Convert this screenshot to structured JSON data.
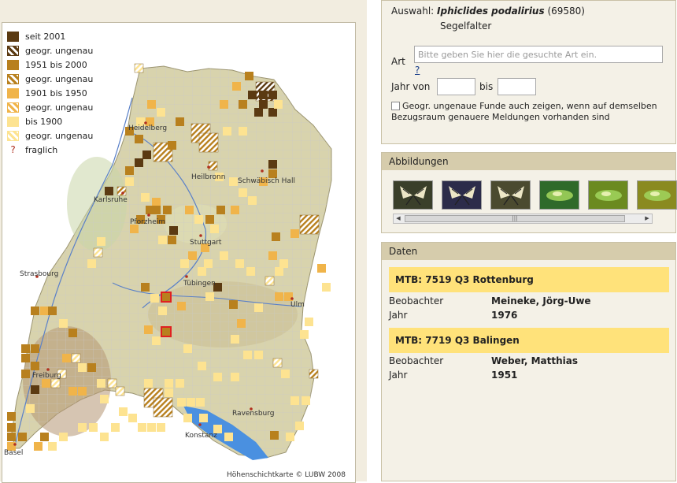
{
  "legend": [
    {
      "label": "seit 2001",
      "color": "#5b3a12",
      "hatched": false
    },
    {
      "label": "geogr. ungenau",
      "color": "#5b3a12",
      "hatched": true
    },
    {
      "label": "1951 bis 2000",
      "color": "#b8801e",
      "hatched": false
    },
    {
      "label": "geogr. ungenau",
      "color": "#b8801e",
      "hatched": true
    },
    {
      "label": "1901 bis 1950",
      "color": "#f0b44a",
      "hatched": false
    },
    {
      "label": "geogr. ungenau",
      "color": "#f0b44a",
      "hatched": true
    },
    {
      "label": "bis 1900",
      "color": "#fde391",
      "hatched": false
    },
    {
      "label": "geogr. ungenau",
      "color": "#fde391",
      "hatched": true
    },
    {
      "label": "fraglich",
      "symbol": "?",
      "hatched": false
    }
  ],
  "map": {
    "cities": {
      "heidelberg": "Heidelberg",
      "heilbronn": "Heilbronn",
      "schwaebisch_hall": "Schwäbisch Hall",
      "karlsruhe": "Karlsruhe",
      "pforzheim": "Pforzheim",
      "stuttgart": "Stuttgart",
      "strasbourg": "Strasbourg",
      "tuebingen": "Tübingen",
      "ulm": "Ulm",
      "freiburg": "Freiburg",
      "ravensburg": "Ravensburg",
      "konstanz": "Konstanz",
      "basel": "Basel"
    },
    "copyright": "Höhenschichtkarte © LUBW 2008"
  },
  "selection": {
    "label": "Auswahl:",
    "species": "Iphiclides podalirius",
    "id": "(69580)",
    "common_name": "Segelfalter",
    "art_label": "Art",
    "art_placeholder": "Bitte geben Sie hier die gesuchte Art ein.",
    "help": "?",
    "year_from_label": "Jahr von",
    "year_to_label": "bis",
    "checkbox_label": "Geogr. ungenaue Funde auch zeigen, wenn auf demselben Bezugsraum genauere Meldungen vorhanden sind"
  },
  "images": {
    "title": "Abbildungen",
    "thumbnails": [
      {
        "icon": "butterfly-photo-1",
        "color": "#3a3f2a"
      },
      {
        "icon": "butterfly-photo-2",
        "color": "#2c2c4a"
      },
      {
        "icon": "butterfly-photo-3",
        "color": "#4b4a30"
      },
      {
        "icon": "caterpillar-photo-1",
        "color": "#2f6a2a"
      },
      {
        "icon": "caterpillar-photo-2",
        "color": "#6b8a20"
      },
      {
        "icon": "caterpillar-photo-3",
        "color": "#8a8a20"
      }
    ],
    "scroll_grip": "|||"
  },
  "data": {
    "title": "Daten",
    "records": [
      {
        "mtb": "MTB: 7519 Q3 Rottenburg",
        "observer_label": "Beobachter",
        "observer": "Meineke, Jörg-Uwe",
        "year_label": "Jahr",
        "year": "1976"
      },
      {
        "mtb": "MTB: 7719 Q3 Balingen",
        "observer_label": "Beobachter",
        "observer": "Weber, Matthias",
        "year_label": "Jahr",
        "year": "1951"
      }
    ]
  }
}
